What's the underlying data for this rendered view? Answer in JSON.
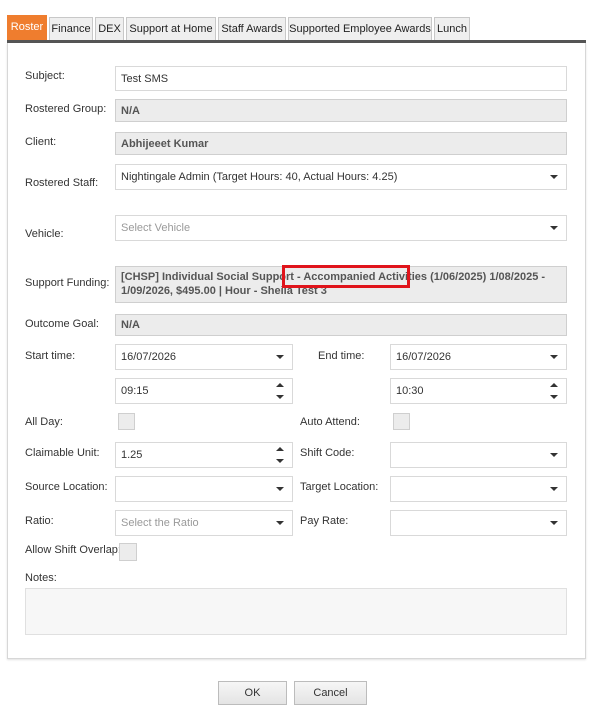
{
  "tabs": [
    {
      "label": "Roster",
      "active": true
    },
    {
      "label": "Finance"
    },
    {
      "label": "DEX"
    },
    {
      "label": "Support at Home"
    },
    {
      "label": "Staff Awards"
    },
    {
      "label": "Supported Employee Awards"
    },
    {
      "label": "Lunch"
    }
  ],
  "form": {
    "subject": {
      "label": "Subject:",
      "value": "Test SMS"
    },
    "rostered_group": {
      "label": "Rostered Group:",
      "value": "N/A"
    },
    "client": {
      "label": "Client:",
      "value": "Abhijeeet Kumar"
    },
    "rostered_staff": {
      "label": "Rostered Staff:",
      "value": "Nightingale Admin (Target Hours: 40, Actual Hours: 4.25)"
    },
    "vehicle": {
      "label": "Vehicle:",
      "placeholder": "Select Vehicle"
    },
    "support_funding": {
      "label": "Support Funding:",
      "value_line1": "[CHSP] Individual Social Support - Accompanied Activities (1/06/2025) 1/08/2025 -",
      "value_line2": "1/09/2026, $495.00 | Hour - Sheila Test 3",
      "highlighted_text": "Accompanied Activities"
    },
    "outcome_goal": {
      "label": "Outcome Goal:",
      "value": "N/A"
    },
    "start_time": {
      "label": "Start time:",
      "date": "16/07/2026",
      "time": "09:15"
    },
    "end_time": {
      "label": "End time:",
      "date": "16/07/2026",
      "time": "10:30"
    },
    "all_day": {
      "label": "All Day:"
    },
    "auto_attend": {
      "label": "Auto Attend:"
    },
    "claimable_unit": {
      "label": "Claimable Unit:",
      "value": "1.25"
    },
    "shift_code": {
      "label": "Shift Code:",
      "value": ""
    },
    "source_location": {
      "label": "Source Location:",
      "value": ""
    },
    "target_location": {
      "label": "Target Location:",
      "value": ""
    },
    "ratio": {
      "label": "Ratio:",
      "placeholder": "Select the Ratio"
    },
    "pay_rate": {
      "label": "Pay Rate:",
      "value": ""
    },
    "allow_shift_overlap": {
      "label": "Allow Shift Overlap:"
    },
    "notes": {
      "label": "Notes:",
      "value": ""
    }
  },
  "buttons": {
    "ok": "OK",
    "cancel": "Cancel"
  },
  "colors": {
    "active_tab": "#ef7d2e",
    "highlight_box": "#e0141b",
    "tab_underline": "#555555"
  }
}
